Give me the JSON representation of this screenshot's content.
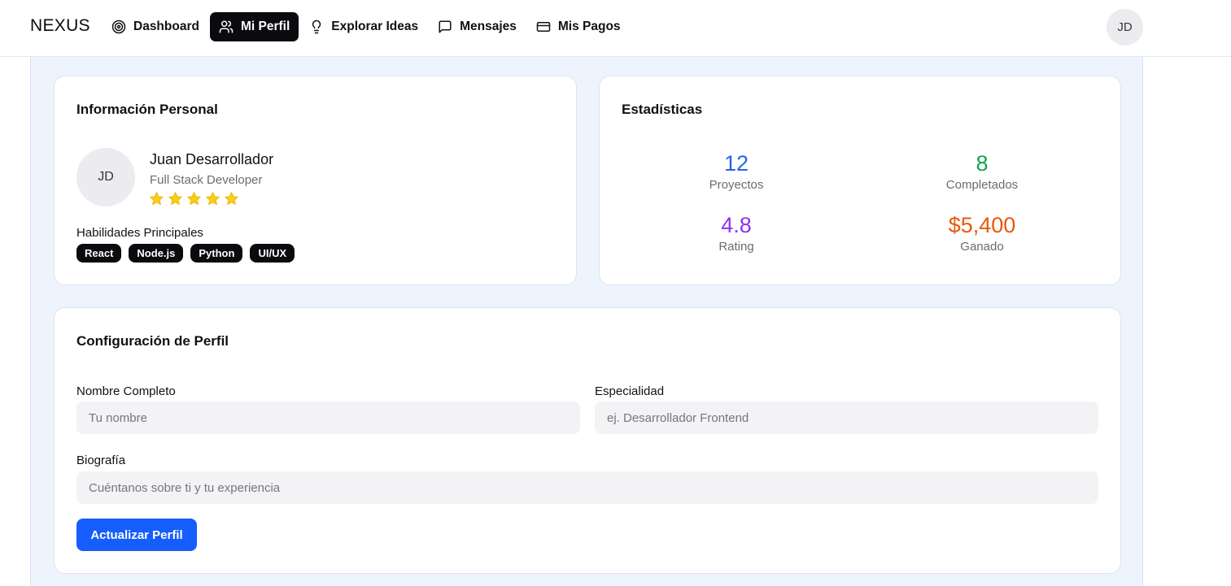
{
  "brand": "NEXUS",
  "nav": [
    {
      "label": "Dashboard",
      "icon": "target-icon",
      "active": false
    },
    {
      "label": "Mi Perfil",
      "icon": "users-icon",
      "active": true
    },
    {
      "label": "Explorar Ideas",
      "icon": "lightbulb-icon",
      "active": false
    },
    {
      "label": "Mensajes",
      "icon": "message-square-icon",
      "active": false
    },
    {
      "label": "Mis Pagos",
      "icon": "credit-card-icon",
      "active": false
    }
  ],
  "user_initials": "JD",
  "personal": {
    "title": "Información Personal",
    "initials": "JD",
    "name": "Juan Desarrollador",
    "role": "Full Stack Developer",
    "rating_stars": 5,
    "skills_label": "Habilidades Principales",
    "skills": [
      "React",
      "Node.js",
      "Python",
      "UI/UX"
    ]
  },
  "stats": {
    "title": "Estadísticas",
    "items": [
      {
        "value": "12",
        "label": "Proyectos",
        "color": "#2563eb"
      },
      {
        "value": "8",
        "label": "Completados",
        "color": "#16a34a"
      },
      {
        "value": "4.8",
        "label": "Rating",
        "color": "#9333ea"
      },
      {
        "value": "$5,400",
        "label": "Ganado",
        "color": "#ea580c"
      }
    ]
  },
  "config": {
    "title": "Configuración de Perfil",
    "name_label": "Nombre Completo",
    "name_placeholder": "Tu nombre",
    "specialty_label": "Especialidad",
    "specialty_placeholder": "ej. Desarrollador Frontend",
    "bio_label": "Biografía",
    "bio_placeholder": "Cuéntanos sobre ti y tu experiencia",
    "submit_label": "Actualizar Perfil"
  },
  "colors": {
    "accent": "#155dfc",
    "star": "#facc15",
    "page_bg": "#eef4fe"
  }
}
